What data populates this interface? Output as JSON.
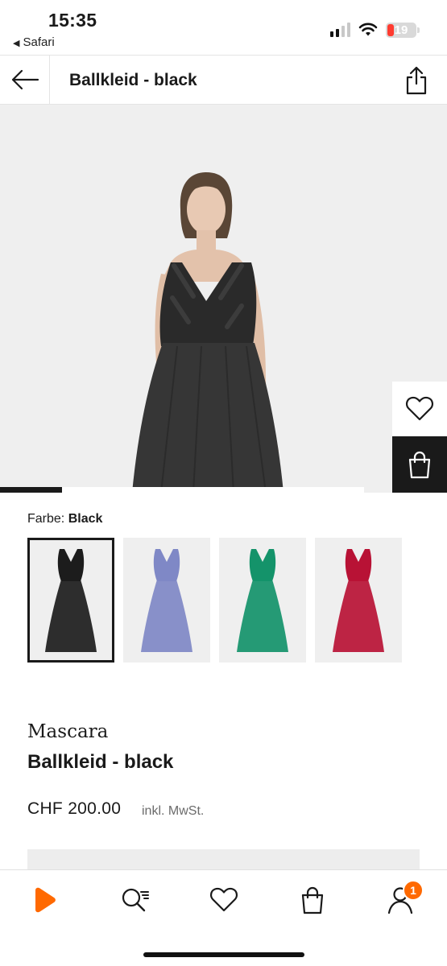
{
  "status_bar": {
    "time": "15:35",
    "back_app": "Safari",
    "battery": "19",
    "icons": [
      "signal-icon",
      "wifi-icon",
      "battery-icon"
    ]
  },
  "header": {
    "title": "Ballkleid - black",
    "back_icon": "arrow-left-icon",
    "share_icon": "share-icon"
  },
  "hero": {
    "wishlist_icon": "heart-icon",
    "bag_icon": "shopping-bag-icon",
    "pager_progress": 0.17
  },
  "color": {
    "label": "Farbe:",
    "selected": "Black",
    "options": [
      {
        "color": "#1c1c1c"
      },
      {
        "color": "#7f88c6"
      },
      {
        "color": "#14936a"
      },
      {
        "color": "#b81235"
      }
    ]
  },
  "product": {
    "brand": "Mascara",
    "name": "Ballkleid - black",
    "price": "CHF 200.00",
    "tax_note": "inkl. MwSt."
  },
  "tabbar": {
    "items": [
      "home-icon",
      "search-icon",
      "wishlist-icon",
      "bag-icon",
      "account-icon"
    ],
    "account_badge": "1"
  },
  "colors": {
    "accent": "#ff6900",
    "dark": "#1a1a1a"
  }
}
